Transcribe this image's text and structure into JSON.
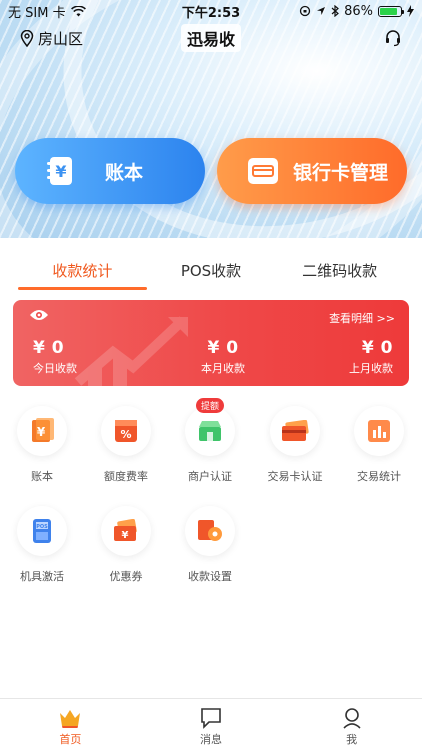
{
  "status": {
    "carrier": "无 SIM 卡",
    "time": "下午2:53",
    "battery": "86%",
    "battery_level": 0.86
  },
  "header": {
    "location": "房山区",
    "title": "迅易收"
  },
  "actions": {
    "ledger": "账本",
    "bankcard": "银行卡管理"
  },
  "tabs": [
    "收款统计",
    "POS收款",
    "二维码收款"
  ],
  "stats": {
    "detail_link": "查看明细 >>",
    "items": [
      {
        "value": "¥ 0",
        "label": "今日收款"
      },
      {
        "value": "¥ 0",
        "label": "本月收款"
      },
      {
        "value": "¥ 0",
        "label": "上月收款"
      }
    ]
  },
  "grid": [
    {
      "label": "账本",
      "icon": "ledger-icon"
    },
    {
      "label": "额度费率",
      "icon": "percent-icon"
    },
    {
      "label": "商户认证",
      "icon": "merchant-icon",
      "badge": "提额"
    },
    {
      "label": "交易卡认证",
      "icon": "card-icon"
    },
    {
      "label": "交易统计",
      "icon": "stats-icon"
    },
    {
      "label": "机具激活",
      "icon": "pos-icon"
    },
    {
      "label": "优惠券",
      "icon": "coupon-icon"
    },
    {
      "label": "收款设置",
      "icon": "settings-icon"
    }
  ],
  "bottom_nav": [
    "首页",
    "消息",
    "我"
  ],
  "colors": {
    "accent": "#f05a20",
    "blue": "#2c83ee",
    "red": "#ef4848"
  }
}
